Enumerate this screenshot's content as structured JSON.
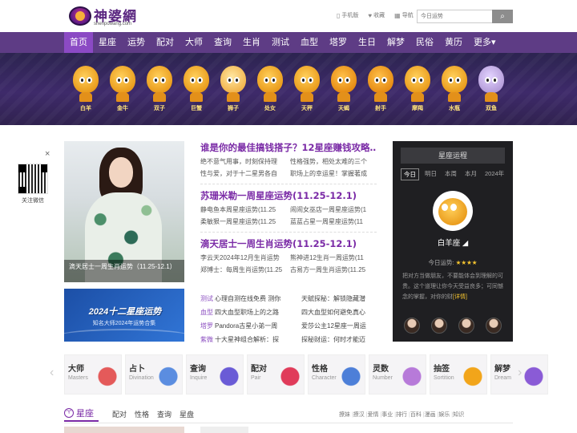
{
  "logo": {
    "name": "神婆網",
    "url": "shenpowang.com"
  },
  "toplinks": [
    {
      "icon": "phone-icon",
      "glyph": "▯",
      "label": "手机版"
    },
    {
      "icon": "heart-icon",
      "glyph": "♥",
      "label": "收藏"
    },
    {
      "icon": "grid-icon",
      "glyph": "▦",
      "label": "导航"
    }
  ],
  "search": {
    "placeholder": "今日运势",
    "icon": "search-icon"
  },
  "nav": [
    "首页",
    "星座",
    "运势",
    "配对",
    "大师",
    "查询",
    "生肖",
    "测试",
    "血型",
    "塔罗",
    "生日",
    "解梦",
    "民俗",
    "黄历",
    "更多▾"
  ],
  "zodiacs": [
    "白羊",
    "金牛",
    "双子",
    "巨蟹",
    "狮子",
    "处女",
    "天秤",
    "天蝎",
    "射手",
    "摩羯",
    "水瓶",
    "双鱼"
  ],
  "qr": {
    "close": "×",
    "label": "关注微信"
  },
  "feature": {
    "caption": "滴天居士一周生肖运势（11.25-12.1）"
  },
  "headlines": [
    {
      "title": "谁是你的最佳搞钱搭子？12星座赚钱攻略…",
      "items": [
        "绝不意气用事，时刻保持理",
        "性格强势，相处太难的三个",
        "性与爱，对于十二星男各自",
        "职场上的幸运星！掌握著成"
      ]
    },
    {
      "title": "苏珊米勒一周星座运势(11.25-12.1)",
      "items": [
        "静电鱼本周星座运势(11.25",
        "闹闹女巫店一周星座运势(1",
        "柔敏狠一周星座运势(11.25",
        "蓝蓝占星一周星座运势(11"
      ]
    },
    {
      "title": "滴天居士一周生肖运势(11.25-12.1)",
      "items": [
        "李云天2024年12月生肖运势",
        "熊神进12生肖一周运势(11",
        "郑博士：每周生肖运势(11.25",
        "古易方一周生肖运势(11.25"
      ]
    }
  ],
  "fortune": {
    "title": "星座运程",
    "tabs": [
      "今日",
      "明日",
      "本周",
      "本月",
      "2024年"
    ],
    "name": "白羊座",
    "score_label": "今日运势:",
    "stars": "★★★★",
    "text": "把对方当做朋友，不要能体会到理解的可贵。这个道理让你今天受益良多；可同憾念的掌握，对你的财",
    "detail": "[详情]"
  },
  "promo": {
    "title": "2024十二星座运势",
    "sub": "知名大师2024年运势合集"
  },
  "tests": [
    {
      "cat": "测试",
      "a": "心理自测在线免费 测你",
      "b": "天赋探秘：解锁隐藏潜"
    },
    {
      "cat": "血型",
      "a": "四大血型职场上的之路",
      "b": "四大血型如何避免真心"
    },
    {
      "cat": "塔罗",
      "a": "Pandora古星小弟一周",
      "b": "爱莎公主12星座一周运"
    },
    {
      "cat": "紫微",
      "a": "十大星神组合解析：探",
      "b": "探秘财运：何时才能迈"
    }
  ],
  "categories": [
    {
      "name": "大师",
      "en": "Masters",
      "icon": "master-icon",
      "color": "#e45a5a"
    },
    {
      "name": "占卜",
      "en": "Divination",
      "icon": "divination-icon",
      "color": "#5b8de0"
    },
    {
      "name": "查询",
      "en": "Inquire",
      "icon": "star-icon",
      "color": "#6a5bd6"
    },
    {
      "name": "配对",
      "en": "Pair",
      "icon": "heart-pair-icon",
      "color": "#e03b5a"
    },
    {
      "name": "性格",
      "en": "Character",
      "icon": "atom-icon",
      "color": "#4d7fd8"
    },
    {
      "name": "灵数",
      "en": "Number",
      "icon": "number-icon",
      "color": "#b77ad9"
    },
    {
      "name": "抽签",
      "en": "Sortition",
      "icon": "sortition-icon",
      "color": "#f2a51a"
    },
    {
      "name": "解梦",
      "en": "Dream",
      "icon": "dream-icon",
      "color": "#8a5bd6"
    }
  ],
  "arrows": {
    "left": "‹",
    "right": "›"
  },
  "section": {
    "title": "星座",
    "tabs": [
      "配对",
      "性格",
      "查询",
      "星盘"
    ],
    "links": [
      "撩妹",
      "撩汉",
      "爱情",
      "事业",
      "排行",
      "百科",
      "漫画",
      "娱乐",
      "知识"
    ]
  }
}
